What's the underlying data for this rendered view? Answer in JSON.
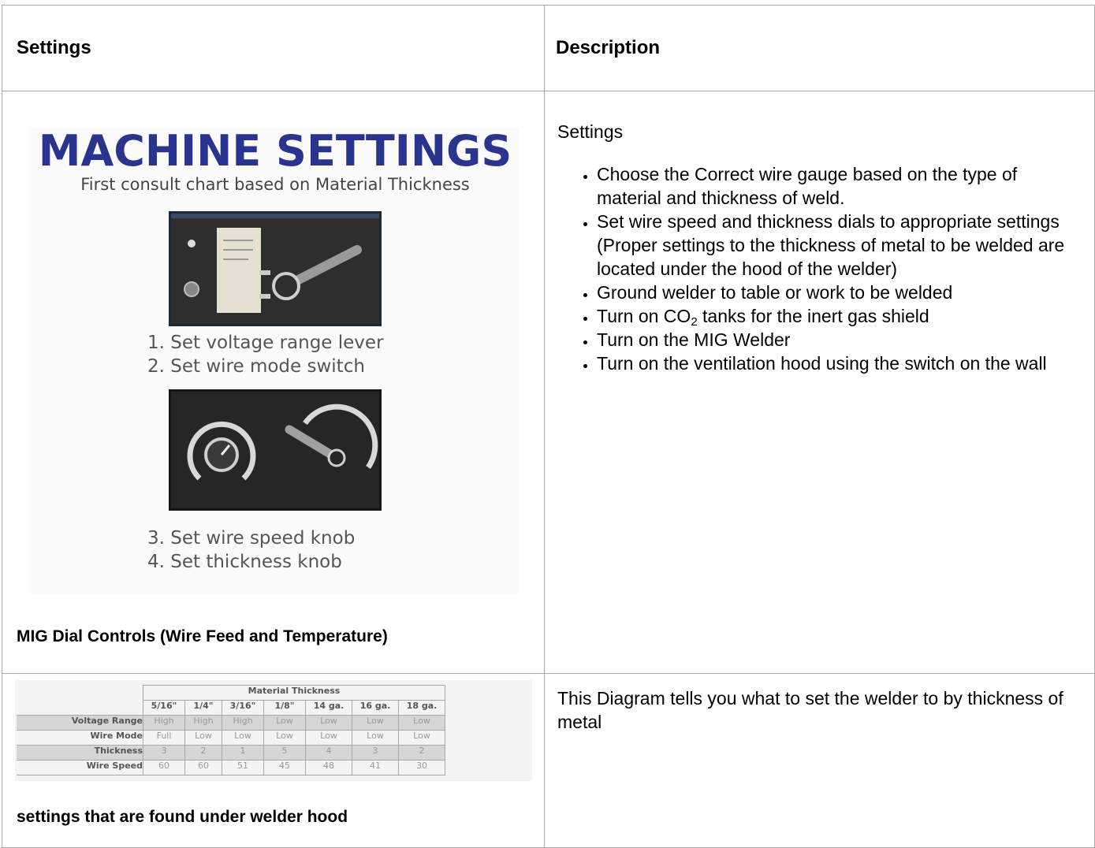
{
  "header": {
    "col1": "Settings",
    "col2": "Description"
  },
  "row1": {
    "image": {
      "title": "MACHINE SETTINGS",
      "subtitle": "First consult chart based on Material Thickness",
      "step1": "1. Set voltage range lever",
      "step2": "2. Set wire mode switch",
      "step3": "3. Set wire speed knob",
      "step4": "4. Set thickness knob"
    },
    "caption": "MIG Dial Controls (Wire Feed and Temperature)",
    "desc_heading": "Settings",
    "bullets": [
      "Choose the Correct wire gauge based on the type of material and thickness of weld.",
      "Set wire speed and thickness dials to appropriate settings (Proper settings to the thickness of metal to be welded are located under the hood of the welder)",
      "Ground welder to table or work to be welded",
      "Turn on CO",
      "2",
      " tanks for the inert gas shield",
      "Turn on the MIG Welder",
      "Turn on the ventilation hood using the switch on the wall"
    ]
  },
  "row2": {
    "chart": {
      "group_header": "Material Thickness",
      "columns": [
        "5/16\"",
        "1/4\"",
        "3/16\"",
        "1/8\"",
        "14 ga.",
        "16 ga.",
        "18 ga."
      ],
      "rows": [
        {
          "label": "Voltage Range",
          "values": [
            "High",
            "High",
            "High",
            "Low",
            "Low",
            "Low",
            "Low"
          ]
        },
        {
          "label": "Wire Mode",
          "values": [
            "Full",
            "Low",
            "Low",
            "Low",
            "Low",
            "Low",
            "Low"
          ]
        },
        {
          "label": "Thickness",
          "values": [
            "3",
            "2",
            "1",
            "5",
            "4",
            "3",
            "2"
          ]
        },
        {
          "label": "Wire Speed",
          "values": [
            "60",
            "60",
            "51",
            "45",
            "48",
            "41",
            "30"
          ]
        }
      ]
    },
    "caption": "settings that are found under welder hood",
    "description": "This Diagram tells you what to set the welder to by thickness of metal"
  }
}
